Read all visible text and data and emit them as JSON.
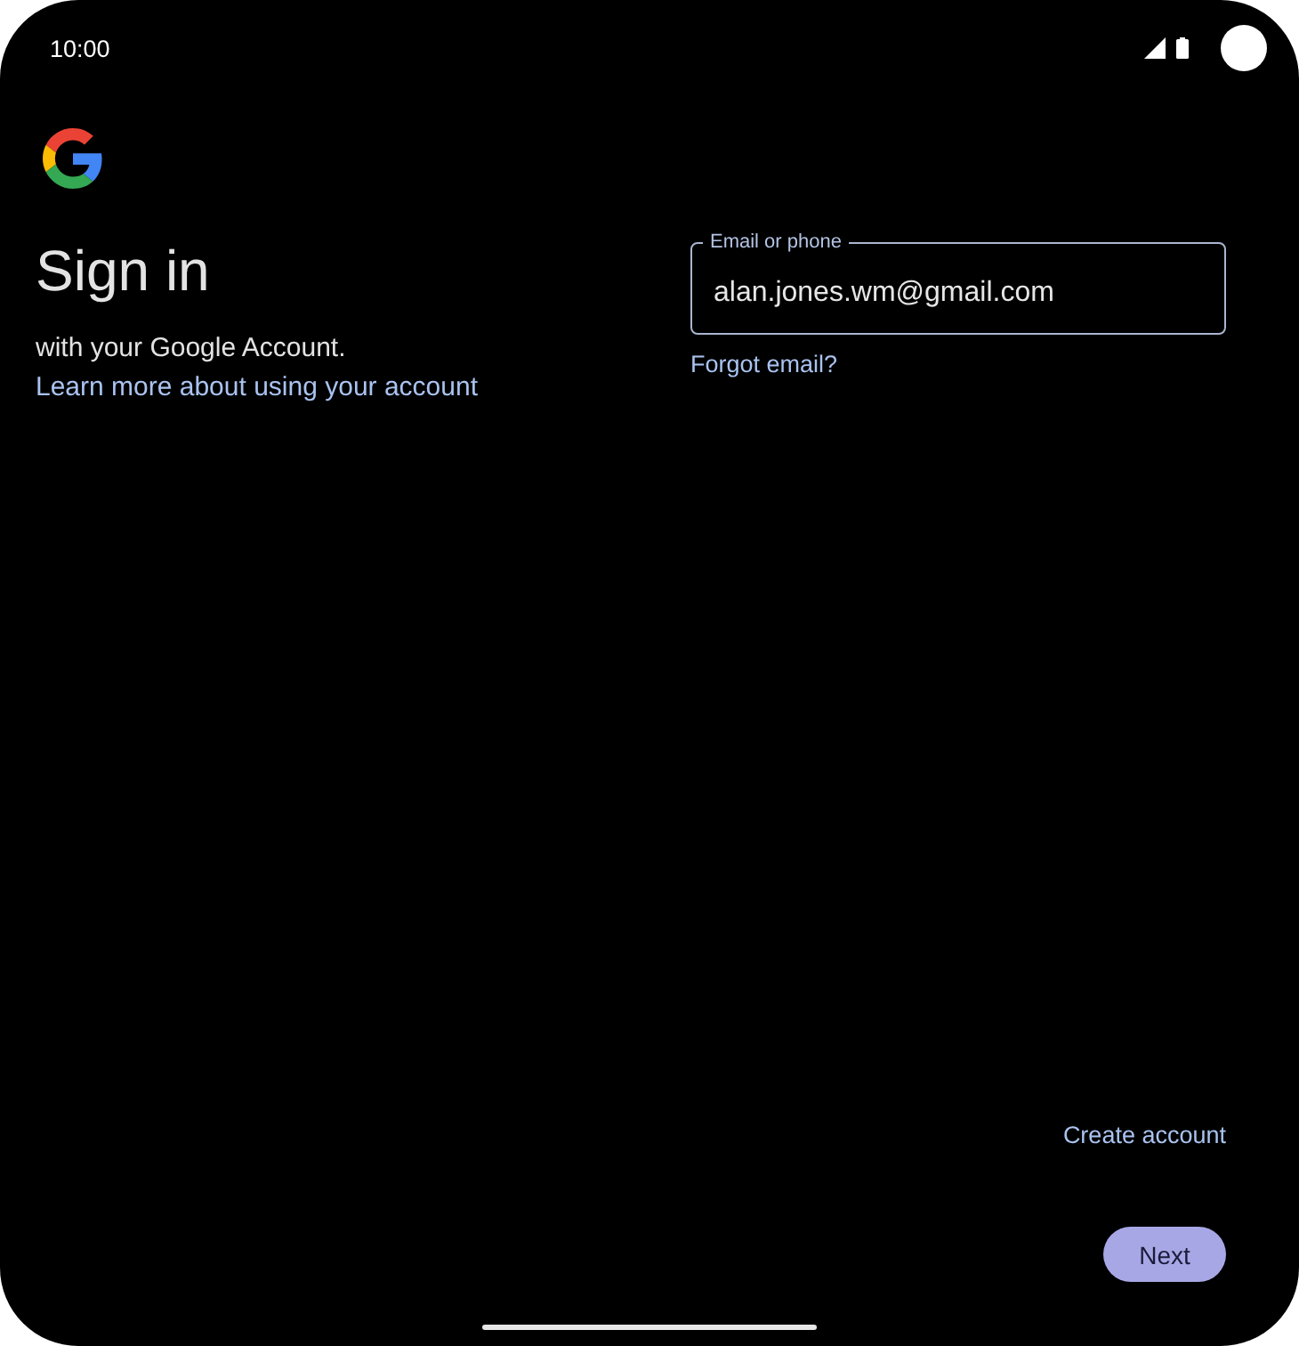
{
  "status_bar": {
    "time": "10:00"
  },
  "header": {
    "title": "Sign in",
    "subtitle": "with your Google Account.",
    "learn_more_link": "Learn more about using your account"
  },
  "email_field": {
    "label": "Email or phone",
    "value": "alan.jones.wm@gmail.com"
  },
  "forgot_email_link": "Forgot email?",
  "create_account_link": "Create account",
  "next_button": "Next"
}
